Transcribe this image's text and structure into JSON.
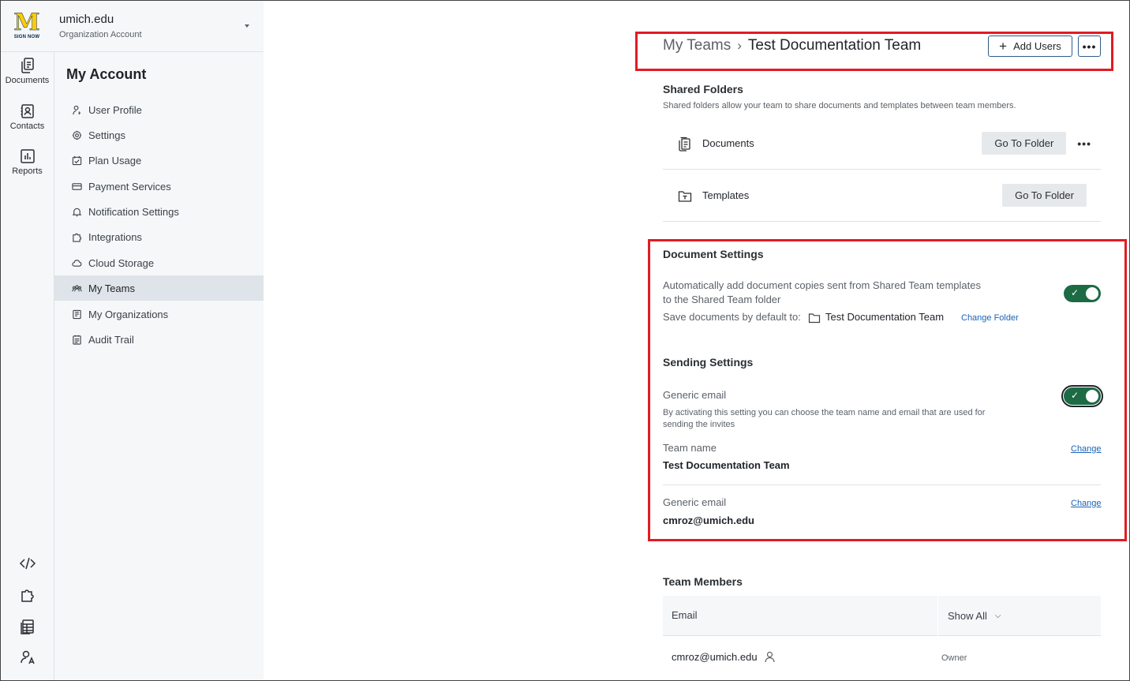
{
  "org": {
    "name": "umich.edu",
    "type": "Organization Account",
    "logo_letter": "M",
    "logo_text": "SIGN NOW"
  },
  "rail": [
    {
      "label": "Documents",
      "icon": "documents-icon"
    },
    {
      "label": "Contacts",
      "icon": "contacts-icon"
    },
    {
      "label": "Reports",
      "icon": "reports-icon"
    }
  ],
  "rail_bottom_icons": [
    "code-icon",
    "puzzle-icon",
    "table-icon",
    "user-language-icon"
  ],
  "menu": {
    "title": "My Account",
    "items": [
      {
        "label": "User Profile",
        "icon": "user-icon"
      },
      {
        "label": "Settings",
        "icon": "gear-icon"
      },
      {
        "label": "Plan Usage",
        "icon": "calendar-check-icon"
      },
      {
        "label": "Payment Services",
        "icon": "card-icon"
      },
      {
        "label": "Notification Settings",
        "icon": "bell-icon"
      },
      {
        "label": "Integrations",
        "icon": "puzzle-icon"
      },
      {
        "label": "Cloud Storage",
        "icon": "cloud-icon"
      },
      {
        "label": "My Teams",
        "icon": "team-icon",
        "active": true
      },
      {
        "label": "My Organizations",
        "icon": "organization-icon"
      },
      {
        "label": "Audit Trail",
        "icon": "audit-icon"
      }
    ]
  },
  "header": {
    "crumb_parent": "My Teams",
    "crumb_current": "Test Documentation Team",
    "add_users_label": "Add Users",
    "more_label": "•••"
  },
  "shared_folders": {
    "title": "Shared Folders",
    "description": "Shared folders allow your team to share documents and templates between team members.",
    "folders": [
      {
        "name": "Documents",
        "button": "Go To Folder",
        "more": "•••"
      },
      {
        "name": "Templates",
        "button": "Go To Folder"
      }
    ]
  },
  "document_settings": {
    "title": "Document Settings",
    "auto_add_line1": "Automatically add document copies sent from Shared Team templates",
    "auto_add_line2": "to the Shared Team folder",
    "save_default_label": "Save documents by default to:",
    "save_default_folder": "Test Documentation Team",
    "change_folder_label": "Change Folder",
    "auto_add_enabled": true
  },
  "sending_settings": {
    "title": "Sending Settings",
    "generic_email_label": "Generic email",
    "generic_email_desc_line1": "By activating this setting you can choose the team name and email that are used for",
    "generic_email_desc_line2": "sending the invites",
    "generic_email_enabled": true,
    "team_name_label": "Team name",
    "team_name_value": "Test Documentation Team",
    "email_label": "Generic email",
    "email_value": "cmroz@umich.edu",
    "change_label": "Change"
  },
  "team_members": {
    "title": "Team Members",
    "col_email": "Email",
    "col_filter": "Show All",
    "rows": [
      {
        "email": "cmroz@umich.edu",
        "role": "Owner"
      }
    ]
  },
  "colors": {
    "toggle_on": "#1c6b45",
    "annotation": "#e21b23",
    "link": "#1a63b5"
  }
}
